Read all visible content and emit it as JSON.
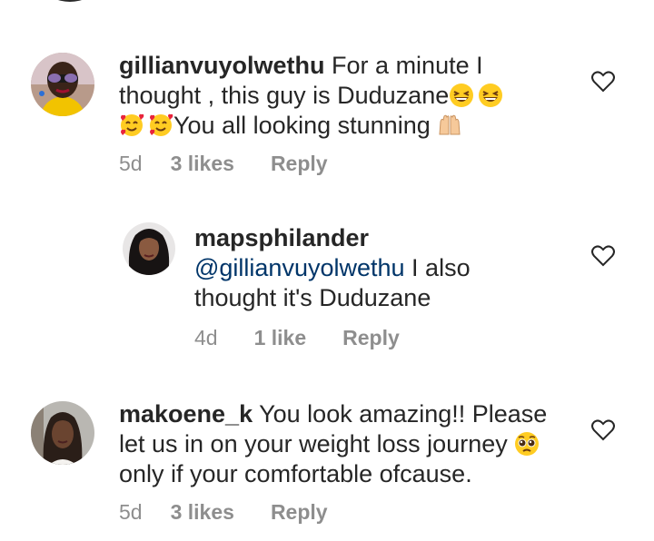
{
  "comments": [
    {
      "username": "gillianvuyolwethu",
      "text_part1": "For a minute I",
      "text_line2": "thought , this guy is Duduzane",
      "text_line3": "You all looking stunning",
      "age": "5d",
      "likes": "3 likes",
      "reply": "Reply",
      "emojis": [
        "grinning-squint-emoji",
        "grinning-squint-emoji",
        "smiling-hearts-emoji",
        "smiling-hearts-emoji",
        "raising-hands-emoji"
      ]
    },
    {
      "username": "mapsphilander",
      "mention": "@gillianvuyolwethu",
      "text_part1": "I also",
      "text_line2": "thought it's Duduzane",
      "age": "4d",
      "likes": "1 like",
      "reply": "Reply"
    },
    {
      "username": "makoene_k",
      "text_part1": "You look amazing!! Please",
      "text_line2": "let us in on your weight loss journey",
      "text_line3": "only if your comfortable ofcause.",
      "age": "5d",
      "likes": "3 likes",
      "reply": "Reply",
      "emojis": [
        "pleading-face-emoji"
      ]
    }
  ],
  "colors": {
    "text": "#262626",
    "meta": "#8e8e8e",
    "mention": "#003569"
  }
}
